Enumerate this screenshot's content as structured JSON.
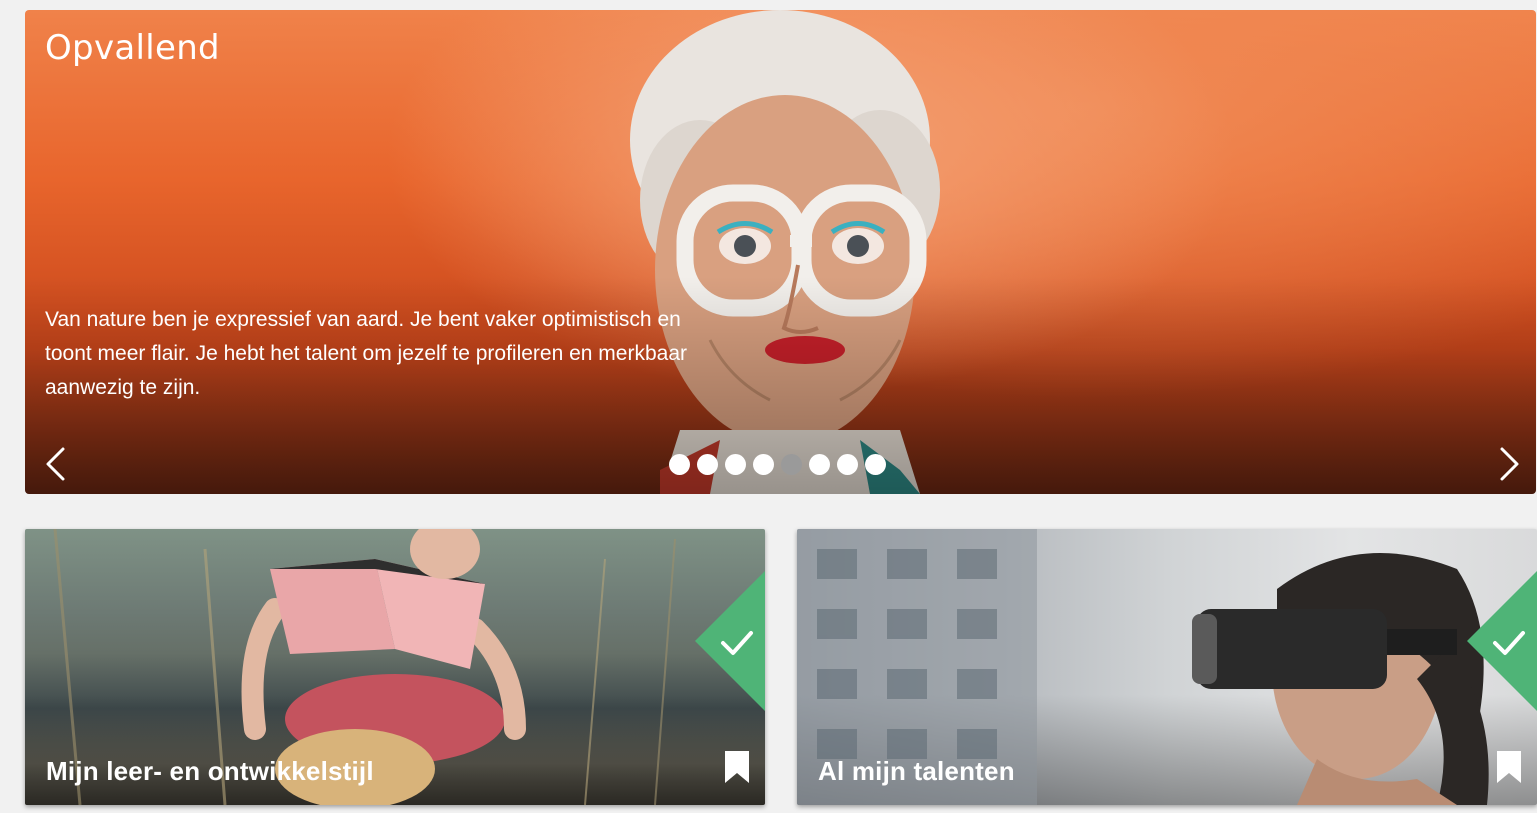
{
  "hero": {
    "title": "Opvallend",
    "description": "Van nature ben je expressief van aard. Je bent vaker optimistisch en toont meer flair. Je hebt het talent om jezelf te profileren en merkbaar aanwezig te zijn.",
    "prev_icon": "chevron-left-icon",
    "next_icon": "chevron-right-icon",
    "dots_total": 8,
    "active_dot": 5,
    "accent_color": "#e8652c"
  },
  "cards": [
    {
      "title": "Mijn leer- en ontwikkelstijl",
      "completed": true,
      "badge_icon": "check-icon",
      "bookmark_icon": "bookmark-icon"
    },
    {
      "title": "Al mijn talenten",
      "completed": true,
      "badge_icon": "check-icon",
      "bookmark_icon": "bookmark-icon"
    }
  ],
  "colors": {
    "badge_green": "#4fb477",
    "text": "#ffffff",
    "page_background": "#f1f1f1"
  }
}
